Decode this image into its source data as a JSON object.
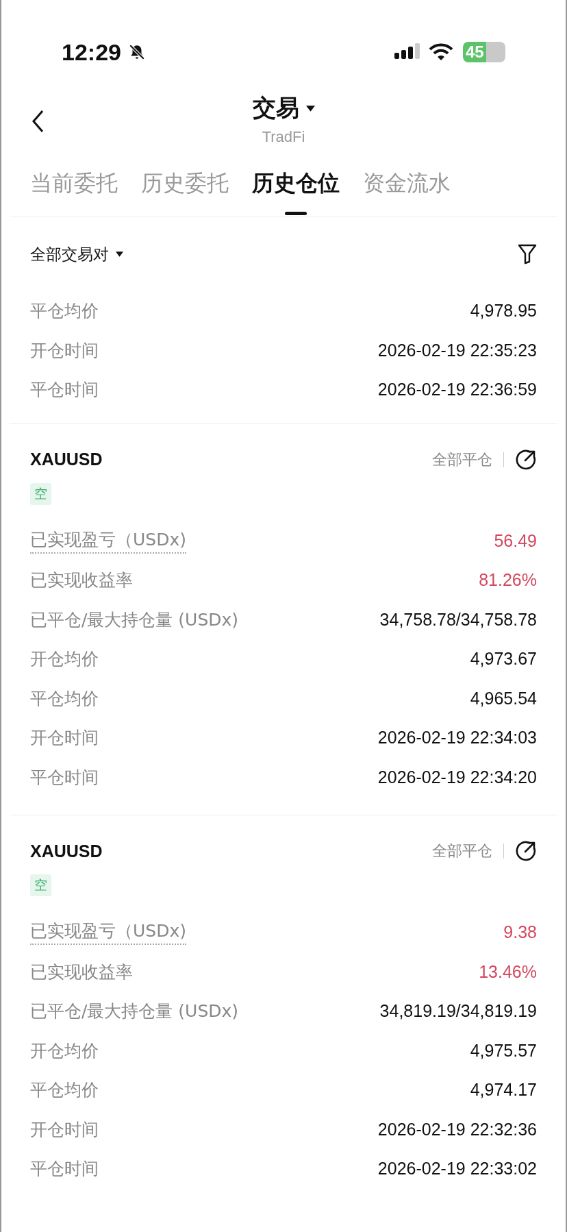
{
  "status_bar": {
    "time": "12:29",
    "battery": "45"
  },
  "header": {
    "title": "交易",
    "subtitle": "TradFi"
  },
  "tabs": [
    {
      "label": "当前委托",
      "selected": false
    },
    {
      "label": "历史委托",
      "selected": false
    },
    {
      "label": "历史仓位",
      "selected": true
    },
    {
      "label": "资金流水",
      "selected": false
    }
  ],
  "filter": {
    "label": "全部交易对"
  },
  "partial_rows": [
    {
      "label": "平仓均价",
      "value": "4,978.95"
    },
    {
      "label": "开仓时间",
      "value": "2026-02-19 22:35:23"
    },
    {
      "label": "平仓时间",
      "value": "2026-02-19 22:36:59"
    }
  ],
  "positions": [
    {
      "symbol": "XAUUSD",
      "close_all": "全部平仓",
      "side": "空",
      "rows": [
        {
          "label": "已实现盈亏（USDx)",
          "value": "56.49",
          "kind": "profit",
          "hint": true
        },
        {
          "label": "已实现收益率",
          "value": "81.26%",
          "kind": "profit",
          "hint": false
        },
        {
          "label": "已平仓/最大持仓量 (USDx)",
          "value": "34,758.78/34,758.78",
          "kind": "plain",
          "hint": false
        },
        {
          "label": "开仓均价",
          "value": "4,973.67",
          "kind": "plain",
          "hint": false
        },
        {
          "label": "平仓均价",
          "value": "4,965.54",
          "kind": "plain",
          "hint": false
        },
        {
          "label": "开仓时间",
          "value": "2026-02-19 22:34:03",
          "kind": "plain",
          "hint": false
        },
        {
          "label": "平仓时间",
          "value": "2026-02-19 22:34:20",
          "kind": "plain",
          "hint": false
        }
      ]
    },
    {
      "symbol": "XAUUSD",
      "close_all": "全部平仓",
      "side": "空",
      "rows": [
        {
          "label": "已实现盈亏（USDx)",
          "value": "9.38",
          "kind": "profit",
          "hint": true
        },
        {
          "label": "已实现收益率",
          "value": "13.46%",
          "kind": "profit",
          "hint": false
        },
        {
          "label": "已平仓/最大持仓量 (USDx)",
          "value": "34,819.19/34,819.19",
          "kind": "plain",
          "hint": false
        },
        {
          "label": "开仓均价",
          "value": "4,975.57",
          "kind": "plain",
          "hint": false
        },
        {
          "label": "平仓均价",
          "value": "4,974.17",
          "kind": "plain",
          "hint": false
        },
        {
          "label": "开仓时间",
          "value": "2026-02-19 22:32:36",
          "kind": "plain",
          "hint": false
        },
        {
          "label": "平仓时间",
          "value": "2026-02-19 22:33:02",
          "kind": "plain",
          "hint": false
        }
      ]
    }
  ]
}
